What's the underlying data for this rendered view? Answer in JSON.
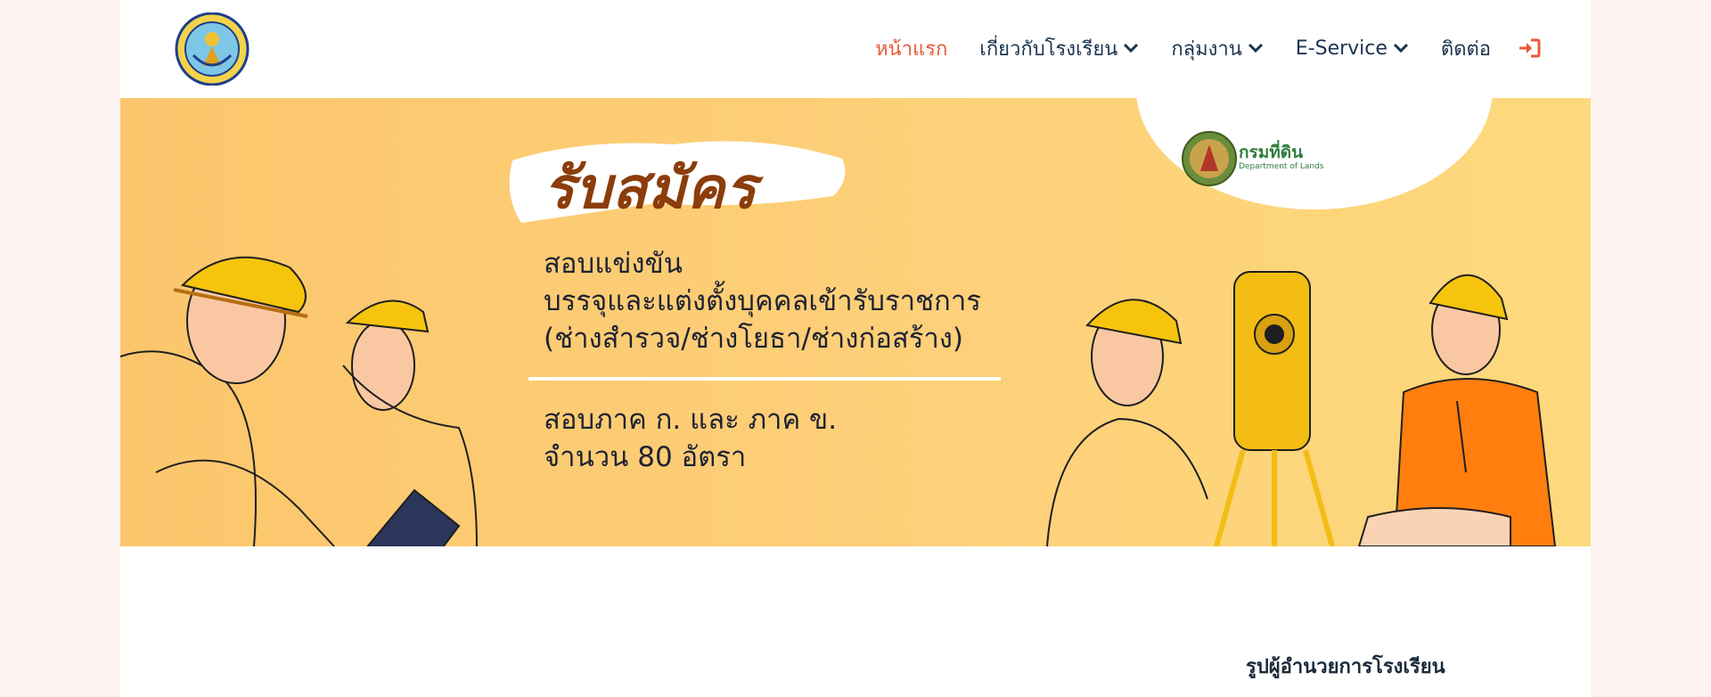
{
  "header": {
    "logo_icon": "school-seal-icon",
    "nav": [
      {
        "label": "หน้าแรก",
        "active": true,
        "dropdown": false
      },
      {
        "label": "เกี่ยวกับโรงเรียน",
        "active": false,
        "dropdown": true
      },
      {
        "label": "กลุ่มงาน",
        "active": false,
        "dropdown": true
      },
      {
        "label": "E-Service",
        "active": false,
        "dropdown": true
      },
      {
        "label": "ติดต่อ",
        "active": false,
        "dropdown": false
      }
    ],
    "login_icon": "sign-in-icon"
  },
  "banner": {
    "headline": "รับสมัคร",
    "lines": [
      "สอบแข่งขัน",
      "บรรจุและแต่งตั้งบุคคลเข้ารับราชการ",
      "(ช่างสำรวจ/ช่างโยธา/ช่างก่อสร้าง)"
    ],
    "details": [
      "สอบภาค ก. และ ภาค ข.",
      "จำนวน 80 อัตรา"
    ],
    "department": {
      "name": "กรมที่ดิน",
      "sub": "Department of Lands",
      "icon": "department-of-lands-seal-icon"
    }
  },
  "main": {
    "section_title": "รูปผู้อำนวยการโรงเรียน"
  },
  "colors": {
    "accent": "#e8593b",
    "nav_text": "#1b3350",
    "banner_bg": "#fdd079",
    "headline": "#8b3d0b",
    "page_bg": "#fdf3f1"
  }
}
